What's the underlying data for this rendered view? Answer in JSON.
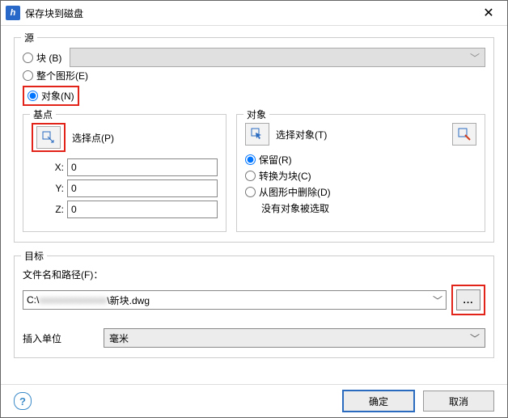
{
  "title": "保存块到磁盘",
  "source": {
    "legend": "源",
    "options": {
      "block": "块 (B)",
      "whole": "整个图形(E)",
      "objects": "对象(N)"
    },
    "selected": "objects"
  },
  "base": {
    "legend": "基点",
    "pick_label": "选择点(P)",
    "x_label": "X:",
    "y_label": "Y:",
    "z_label": "Z:",
    "x": "0",
    "y": "0",
    "z": "0"
  },
  "objects": {
    "legend": "对象",
    "select_label": "选择对象(T)",
    "options": {
      "retain": "保留(R)",
      "convert": "转换为块(C)",
      "delete": "从图形中删除(D)"
    },
    "selected": "retain",
    "note": "没有对象被选取"
  },
  "target": {
    "legend": "目标",
    "path_label": "文件名和路径(F)：",
    "path_prefix": "C:\\",
    "path_hidden": "xxxxxxxxxxxxxx",
    "path_suffix": "\\新块.dwg",
    "browse": "...",
    "unit_label": "插入单位",
    "unit_value": "毫米"
  },
  "buttons": {
    "ok": "确定",
    "cancel": "取消"
  },
  "icons": {
    "pick_point": "pick-point-icon",
    "select_objects": "select-objects-icon",
    "quick_select": "quick-select-icon",
    "help": "?"
  }
}
